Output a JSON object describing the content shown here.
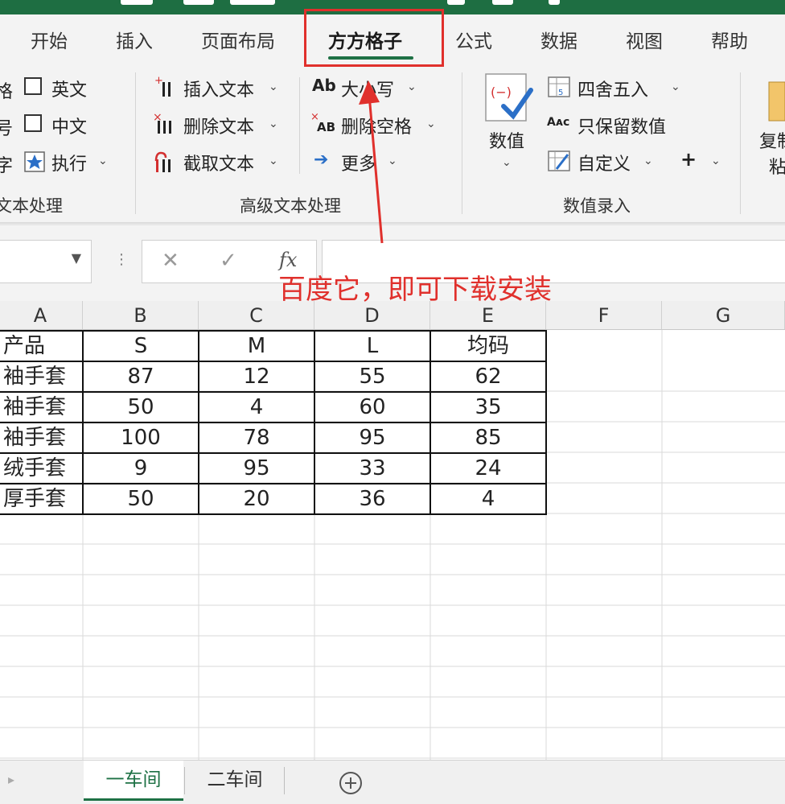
{
  "ribbon_tabs": [
    {
      "label": "开始",
      "active": false
    },
    {
      "label": "插入",
      "active": false
    },
    {
      "label": "页面布局",
      "active": false
    },
    {
      "label": "方方格子",
      "active": true
    },
    {
      "label": "公式",
      "active": false
    },
    {
      "label": "数据",
      "active": false
    },
    {
      "label": "视图",
      "active": false
    },
    {
      "label": "帮助",
      "active": false
    }
  ],
  "ribbon": {
    "group1": {
      "cut_left_1": "格",
      "cut_left_2": "号",
      "cut_left_3": "字",
      "check_english": "英文",
      "check_chinese": "中文",
      "execute": "执行",
      "group_label": "文本处理"
    },
    "group2": {
      "insert_text": "插入文本",
      "delete_text": "删除文本",
      "extract_text": "截取文本",
      "case": "大小写",
      "delete_space": "删除空格",
      "more": "更多",
      "group_label": "高级文本处理"
    },
    "group3": {
      "value_button": "数值",
      "round": "四舍五入",
      "keep_values": "只保留数值",
      "custom": "自定义",
      "plus": "+",
      "group_label": "数值录入"
    },
    "group4": {
      "copy_paste_1": "复制",
      "copy_paste_2": "粘贴"
    }
  },
  "formula_bar": {
    "fx_label": "fx",
    "cancel": "✕",
    "confirm": "✓",
    "name_box_value": ""
  },
  "annotation": "百度它，即可下载安装",
  "columns": [
    "A",
    "B",
    "C",
    "D",
    "E",
    "F",
    "G"
  ],
  "table": {
    "header": [
      "产品",
      "S",
      "M",
      "L",
      "均码"
    ],
    "rows": [
      [
        "袖手套",
        "87",
        "12",
        "55",
        "62"
      ],
      [
        "袖手套",
        "50",
        "4",
        "60",
        "35"
      ],
      [
        "袖手套",
        "100",
        "78",
        "95",
        "85"
      ],
      [
        "绒手套",
        "9",
        "95",
        "33",
        "24"
      ],
      [
        "厚手套",
        "50",
        "20",
        "36",
        "4"
      ]
    ]
  },
  "sheets": [
    {
      "label": "一车间",
      "active": true
    },
    {
      "label": "二车间",
      "active": false
    }
  ],
  "colors": {
    "accent_green": "#1e7145",
    "annotation_red": "#e0302c"
  }
}
